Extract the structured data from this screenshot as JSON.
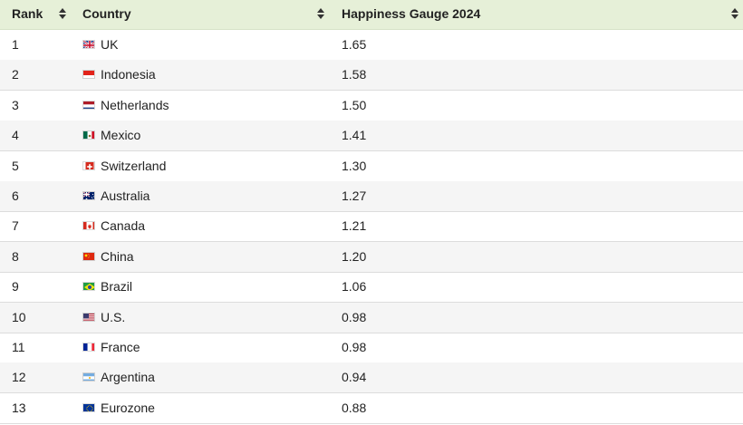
{
  "table": {
    "headers": {
      "rank": "Rank",
      "country": "Country",
      "value": "Happiness Gauge 2024"
    },
    "rows": [
      {
        "rank": "1",
        "country": "UK",
        "flag": "flag-uk-icon",
        "value": "1.65"
      },
      {
        "rank": "2",
        "country": "Indonesia",
        "flag": "flag-indonesia-icon",
        "value": "1.58"
      },
      {
        "rank": "3",
        "country": "Netherlands",
        "flag": "flag-netherlands-icon",
        "value": "1.50"
      },
      {
        "rank": "4",
        "country": "Mexico",
        "flag": "flag-mexico-icon",
        "value": "1.41"
      },
      {
        "rank": "5",
        "country": "Switzerland",
        "flag": "flag-switzerland-icon",
        "value": "1.30"
      },
      {
        "rank": "6",
        "country": "Australia",
        "flag": "flag-australia-icon",
        "value": "1.27"
      },
      {
        "rank": "7",
        "country": "Canada",
        "flag": "flag-canada-icon",
        "value": "1.21"
      },
      {
        "rank": "8",
        "country": "China",
        "flag": "flag-china-icon",
        "value": "1.20"
      },
      {
        "rank": "9",
        "country": "Brazil",
        "flag": "flag-brazil-icon",
        "value": "1.06"
      },
      {
        "rank": "10",
        "country": "U.S.",
        "flag": "flag-us-icon",
        "value": "0.98"
      },
      {
        "rank": "11",
        "country": "France",
        "flag": "flag-france-icon",
        "value": "0.98"
      },
      {
        "rank": "12",
        "country": "Argentina",
        "flag": "flag-argentina-icon",
        "value": "0.94"
      },
      {
        "rank": "13",
        "country": "Eurozone",
        "flag": "flag-eurozone-icon",
        "value": "0.88"
      }
    ]
  },
  "colors": {
    "header_bg": "#e6f0d8",
    "row_alt_bg": "#f5f5f5",
    "border": "#dcdcdc"
  }
}
